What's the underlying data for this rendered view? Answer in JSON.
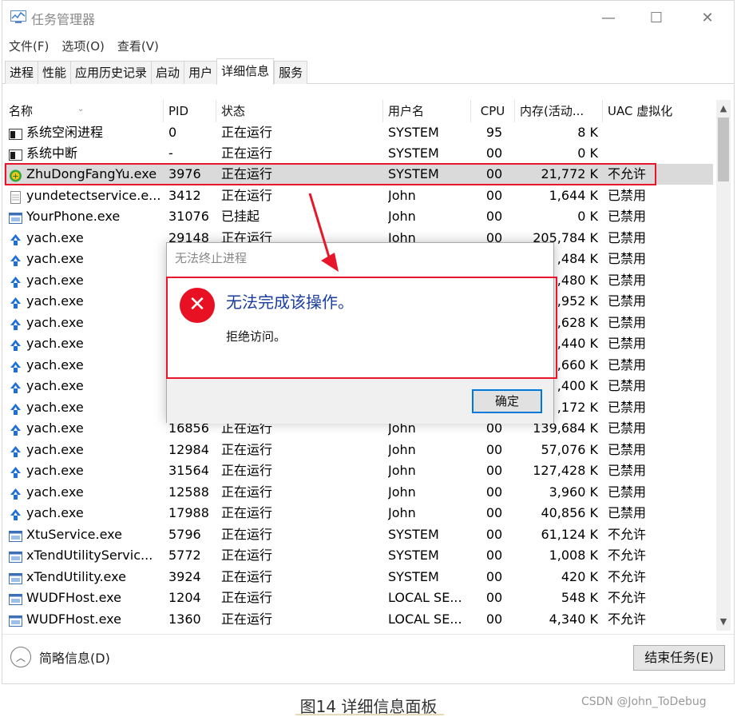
{
  "window": {
    "title": "任务管理器",
    "controls": {
      "minimize": "—",
      "maximize": "☐",
      "close": "✕"
    }
  },
  "menu": [
    "文件(F)",
    "选项(O)",
    "查看(V)"
  ],
  "tabs": [
    {
      "label": "进程",
      "active": false
    },
    {
      "label": "性能",
      "active": false
    },
    {
      "label": "应用历史记录",
      "active": false
    },
    {
      "label": "启动",
      "active": false
    },
    {
      "label": "用户",
      "active": false
    },
    {
      "label": "详细信息",
      "active": true
    },
    {
      "label": "服务",
      "active": false
    }
  ],
  "table": {
    "columns": [
      "名称",
      "PID",
      "状态",
      "用户名",
      "CPU",
      "内存(活动...",
      "UAC 虚拟化"
    ],
    "rows": [
      {
        "icon": "system-process-icon",
        "name": "系统空闲进程",
        "pid": "0",
        "status": "正在运行",
        "user": "SYSTEM",
        "cpu": "95",
        "mem": "8 K",
        "uac": ""
      },
      {
        "icon": "system-process-icon",
        "name": "系统中断",
        "pid": "-",
        "status": "正在运行",
        "user": "SYSTEM",
        "cpu": "00",
        "mem": "0 K",
        "uac": ""
      },
      {
        "icon": "zhudong-shield-icon",
        "name": "ZhuDongFangYu.exe",
        "pid": "3976",
        "status": "正在运行",
        "user": "SYSTEM",
        "cpu": "00",
        "mem": "21,772 K",
        "uac": "不允许",
        "selected": true
      },
      {
        "icon": "document-icon",
        "name": "yundetectservice.e...",
        "pid": "3412",
        "status": "正在运行",
        "user": "John",
        "cpu": "00",
        "mem": "1,644 K",
        "uac": "已禁用"
      },
      {
        "icon": "app-window-icon",
        "name": "YourPhone.exe",
        "pid": "31076",
        "status": "已挂起",
        "user": "John",
        "cpu": "00",
        "mem": "0 K",
        "uac": "已禁用"
      },
      {
        "icon": "yach-icon",
        "name": "yach.exe",
        "pid": "29148",
        "status": "正在运行",
        "user": "John",
        "cpu": "00",
        "mem": "205,784 K",
        "uac": "已禁用"
      },
      {
        "icon": "yach-icon",
        "name": "yach.exe",
        "pid": "",
        "status": "",
        "user": "",
        "cpu": "",
        "mem": ",484 K",
        "uac": "已禁用"
      },
      {
        "icon": "yach-icon",
        "name": "yach.exe",
        "pid": "",
        "status": "",
        "user": "",
        "cpu": "",
        "mem": ",480 K",
        "uac": "已禁用"
      },
      {
        "icon": "yach-icon",
        "name": "yach.exe",
        "pid": "",
        "status": "",
        "user": "",
        "cpu": "",
        "mem": ",952 K",
        "uac": "已禁用"
      },
      {
        "icon": "yach-icon",
        "name": "yach.exe",
        "pid": "",
        "status": "",
        "user": "",
        "cpu": "",
        "mem": ",628 K",
        "uac": "已禁用"
      },
      {
        "icon": "yach-icon",
        "name": "yach.exe",
        "pid": "",
        "status": "",
        "user": "",
        "cpu": "",
        "mem": ",440 K",
        "uac": "已禁用"
      },
      {
        "icon": "yach-icon",
        "name": "yach.exe",
        "pid": "",
        "status": "",
        "user": "",
        "cpu": "",
        "mem": ",660 K",
        "uac": "已禁用"
      },
      {
        "icon": "yach-icon",
        "name": "yach.exe",
        "pid": "",
        "status": "",
        "user": "",
        "cpu": "",
        "mem": ",400 K",
        "uac": "已禁用"
      },
      {
        "icon": "yach-icon",
        "name": "yach.exe",
        "pid": "",
        "status": "",
        "user": "",
        "cpu": "",
        "mem": ",172 K",
        "uac": "已禁用"
      },
      {
        "icon": "yach-icon",
        "name": "yach.exe",
        "pid": "16856",
        "status": "正在运行",
        "user": "John",
        "cpu": "00",
        "mem": "139,684 K",
        "uac": "已禁用"
      },
      {
        "icon": "yach-icon",
        "name": "yach.exe",
        "pid": "12984",
        "status": "正在运行",
        "user": "John",
        "cpu": "00",
        "mem": "57,076 K",
        "uac": "已禁用"
      },
      {
        "icon": "yach-icon",
        "name": "yach.exe",
        "pid": "31564",
        "status": "正在运行",
        "user": "John",
        "cpu": "00",
        "mem": "127,428 K",
        "uac": "已禁用"
      },
      {
        "icon": "yach-icon",
        "name": "yach.exe",
        "pid": "12588",
        "status": "正在运行",
        "user": "John",
        "cpu": "00",
        "mem": "3,960 K",
        "uac": "已禁用"
      },
      {
        "icon": "yach-icon",
        "name": "yach.exe",
        "pid": "17988",
        "status": "正在运行",
        "user": "John",
        "cpu": "00",
        "mem": "40,856 K",
        "uac": "已禁用"
      },
      {
        "icon": "app-window-icon",
        "name": "XtuService.exe",
        "pid": "5796",
        "status": "正在运行",
        "user": "SYSTEM",
        "cpu": "00",
        "mem": "61,124 K",
        "uac": "不允许"
      },
      {
        "icon": "app-window-icon",
        "name": "xTendUtilityServic...",
        "pid": "5772",
        "status": "正在运行",
        "user": "SYSTEM",
        "cpu": "00",
        "mem": "1,008 K",
        "uac": "不允许"
      },
      {
        "icon": "app-window-icon",
        "name": "xTendUtility.exe",
        "pid": "3924",
        "status": "正在运行",
        "user": "SYSTEM",
        "cpu": "00",
        "mem": "420 K",
        "uac": "不允许"
      },
      {
        "icon": "app-window-icon",
        "name": "WUDFHost.exe",
        "pid": "1204",
        "status": "正在运行",
        "user": "LOCAL SE...",
        "cpu": "00",
        "mem": "548 K",
        "uac": "不允许"
      },
      {
        "icon": "app-window-icon",
        "name": "WUDFHost.exe",
        "pid": "1360",
        "status": "正在运行",
        "user": "LOCAL SE...",
        "cpu": "00",
        "mem": "4,340 K",
        "uac": "不允许"
      }
    ]
  },
  "footer": {
    "fewer_details": "简略信息(D)",
    "end_task": "结束任务(E)"
  },
  "dialog": {
    "title": "无法终止进程",
    "main": "无法完成该操作。",
    "detail": "拒绝访问。",
    "ok": "确定"
  },
  "caption": "图14 详细信息面板",
  "watermark": "CSDN @John_ToDebug",
  "colors": {
    "highlight_red": "#e8162a",
    "dialog_heading_blue": "#1a3d9e",
    "error_red": "#e81123",
    "focus_blue": "#0078d7",
    "yach_blue": "#1e6fd9"
  }
}
